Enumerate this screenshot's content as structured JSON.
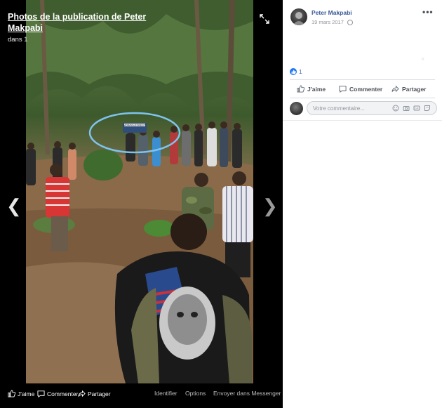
{
  "viewer": {
    "title": "Photos de la publication de Peter Makpabi",
    "subtitle": "dans 1",
    "sign_text": "MORAYA (FOREST)",
    "bottom_bar": {
      "like": "J'aime",
      "comment": "Commenter",
      "share": "Partager",
      "tag": "Identifier",
      "options": "Options",
      "messenger": "Envoyer dans Messenger"
    }
  },
  "post": {
    "author": "Peter Makpabi",
    "date": "19 mars 2017",
    "reaction_count": "1",
    "actions": {
      "like": "J'aime",
      "comment": "Commenter",
      "share": "Partager"
    },
    "comment_placeholder": "Votre commentaire..."
  },
  "colors": {
    "link_blue": "#385898",
    "like_blue": "#2078f4",
    "viewer_bg": "#000000",
    "ellipse": "#7ec3f0"
  }
}
